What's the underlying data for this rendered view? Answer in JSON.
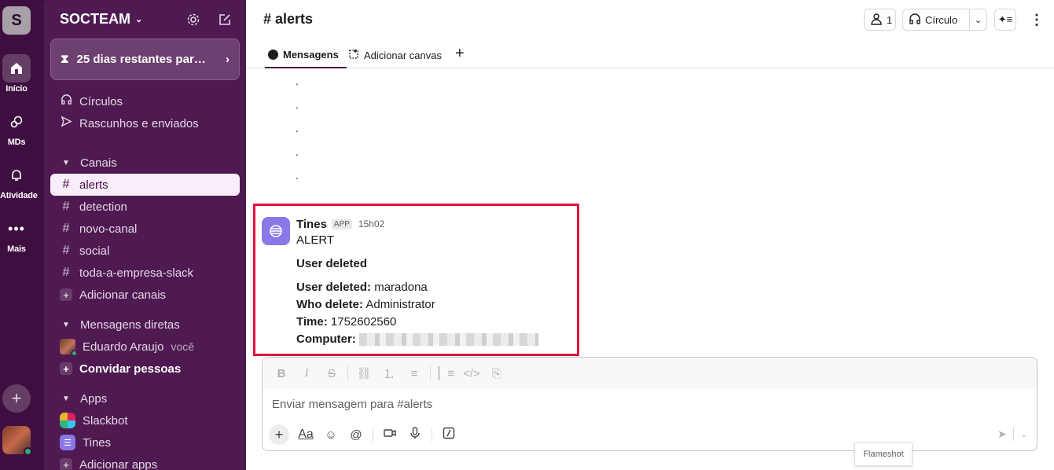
{
  "rail": {
    "workspace_initial": "S",
    "items": [
      {
        "label": "Início",
        "icon": "home-icon"
      },
      {
        "label": "MDs",
        "icon": "dm-icon"
      },
      {
        "label": "Atividade",
        "icon": "bell-icon"
      },
      {
        "label": "Mais",
        "icon": "more-icon"
      }
    ]
  },
  "sidebar": {
    "workspace_name": "SOCTEAM",
    "trial_text": "25 dias restantes par…",
    "nav": [
      {
        "label": "Círculos",
        "icon": "headphones-icon"
      },
      {
        "label": "Rascunhos e enviados",
        "icon": "send-icon"
      }
    ],
    "channels_header": "Canais",
    "channels": [
      "alerts",
      "detection",
      "novo-canal",
      "social",
      "toda-a-empresa-slack"
    ],
    "add_channels": "Adicionar canais",
    "dms_header": "Mensagens diretas",
    "dm_user": "Eduardo Araujo",
    "dm_you": "você",
    "invite": "Convidar pessoas",
    "apps_header": "Apps",
    "apps": [
      "Slackbot",
      "Tines"
    ],
    "add_apps": "Adicionar apps"
  },
  "header": {
    "channel": "# alerts",
    "members_count": "1",
    "huddle_label": "Círculo",
    "tabs": {
      "messages": "Mensagens",
      "canvas": "Adicionar canvas"
    }
  },
  "messages": {
    "dots": [
      ".",
      ".",
      ".",
      ".",
      "."
    ],
    "author": "Tines",
    "app_badge": "APP",
    "time": "15h02",
    "title": "ALERT",
    "subtitle": "User deleted",
    "fields": [
      {
        "k": "User deleted:",
        "v": "maradona"
      },
      {
        "k": "Who delete:",
        "v": "Administrator"
      },
      {
        "k": "Time:",
        "v": "1752602560"
      },
      {
        "k": "Computer:",
        "v": ""
      }
    ]
  },
  "composer": {
    "placeholder": "Enviar mensagem para #alerts",
    "format_label": "Aa"
  },
  "tooltip": "Flameshot",
  "colors": {
    "rail": "#3f0e40",
    "sidebar": "#4f1a52",
    "highlight": "#e0143c",
    "tines": "#8a78e6"
  }
}
